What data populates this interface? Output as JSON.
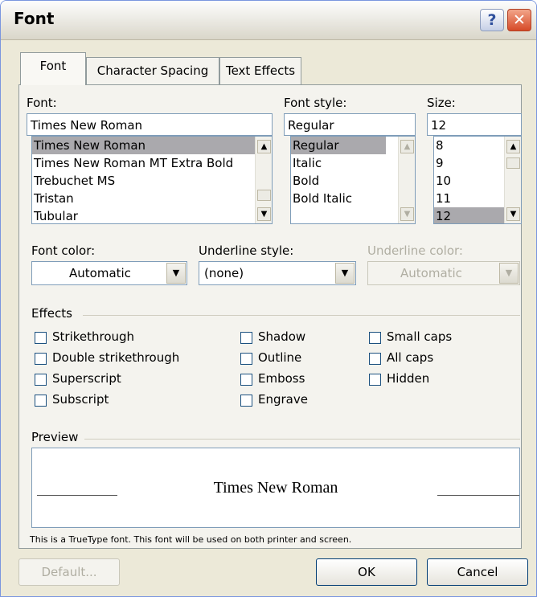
{
  "window": {
    "title": "Font",
    "help_label": "?",
    "close_label": "✕"
  },
  "tabs": [
    {
      "label": "Font",
      "active": true
    },
    {
      "label": "Character Spacing",
      "active": false
    },
    {
      "label": "Text Effects",
      "active": false
    }
  ],
  "font": {
    "label": "Font:",
    "value": "Times New Roman",
    "list": [
      "Times New Roman",
      "Times New Roman MT Extra Bold",
      "Trebuchet MS",
      "Tristan",
      "Tubular"
    ],
    "selected": "Times New Roman"
  },
  "font_style": {
    "label": "Font style:",
    "value": "Regular",
    "list": [
      "Regular",
      "Italic",
      "Bold",
      "Bold Italic"
    ],
    "selected": "Regular"
  },
  "size": {
    "label": "Size:",
    "value": "12",
    "list": [
      "8",
      "9",
      "10",
      "11",
      "12"
    ],
    "selected": "12"
  },
  "font_color": {
    "label": "Font color:",
    "value": "Automatic"
  },
  "underline_style": {
    "label": "Underline style:",
    "value": "(none)"
  },
  "underline_color": {
    "label": "Underline color:",
    "value": "Automatic",
    "disabled": true
  },
  "effects": {
    "label": "Effects",
    "items": [
      {
        "label": "Strikethrough",
        "checked": false
      },
      {
        "label": "Double strikethrough",
        "checked": false
      },
      {
        "label": "Superscript",
        "checked": false
      },
      {
        "label": "Subscript",
        "checked": false
      },
      {
        "label": "Shadow",
        "checked": false
      },
      {
        "label": "Outline",
        "checked": false
      },
      {
        "label": "Emboss",
        "checked": false
      },
      {
        "label": "Engrave",
        "checked": false
      },
      {
        "label": "Small caps",
        "checked": false
      },
      {
        "label": "All caps",
        "checked": false
      },
      {
        "label": "Hidden",
        "checked": false
      }
    ]
  },
  "preview": {
    "label": "Preview",
    "text": "Times New Roman",
    "note": "This is a TrueType font. This font will be used on both printer and screen."
  },
  "buttons": {
    "default": "Default...",
    "ok": "OK",
    "cancel": "Cancel"
  }
}
